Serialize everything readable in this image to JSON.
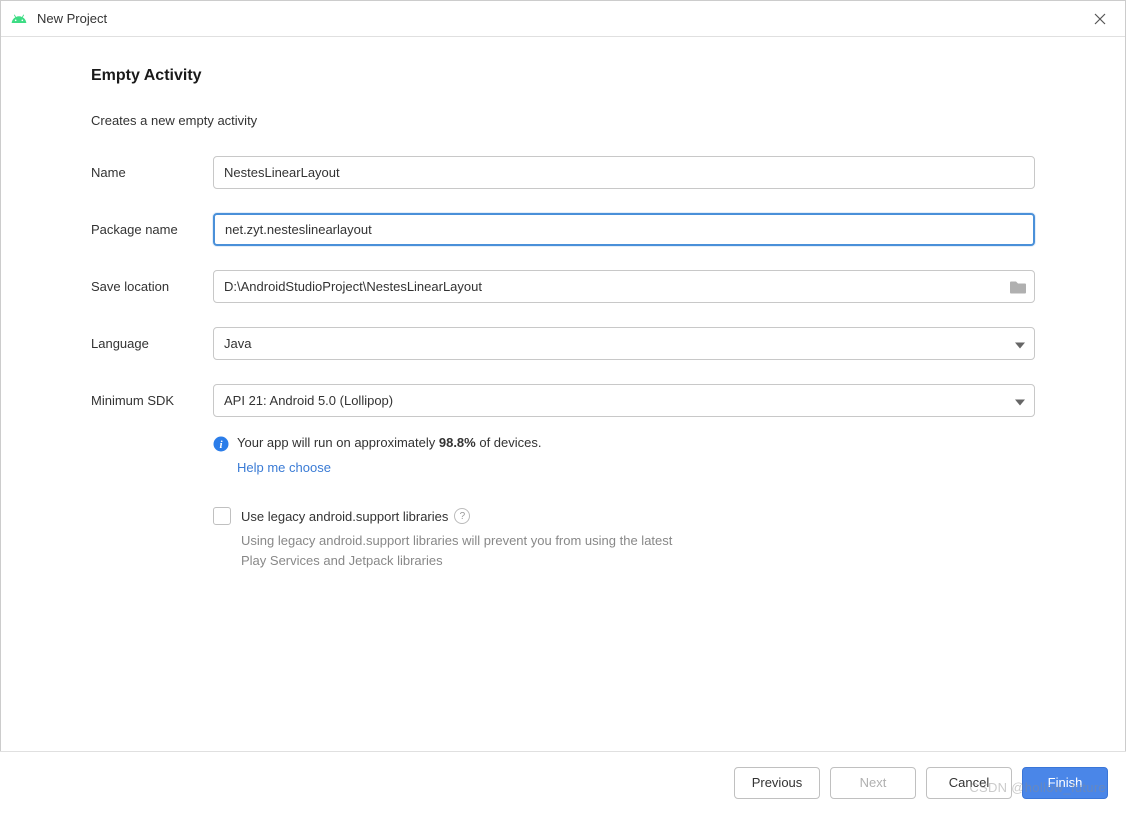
{
  "window": {
    "title": "New Project"
  },
  "page": {
    "heading": "Empty Activity",
    "description": "Creates a new empty activity"
  },
  "form": {
    "name": {
      "label": "Name",
      "value": "NestesLinearLayout"
    },
    "package_name": {
      "label": "Package name",
      "value": "net.zyt.nesteslinearlayout"
    },
    "save_location": {
      "label": "Save location",
      "value": "D:\\AndroidStudioProject\\NestesLinearLayout"
    },
    "language": {
      "label": "Language",
      "value": "Java"
    },
    "minimum_sdk": {
      "label": "Minimum SDK",
      "value": "API 21: Android 5.0 (Lollipop)"
    }
  },
  "info": {
    "text_prefix": "Your app will run on approximately ",
    "percentage": "98.8%",
    "text_suffix": " of devices.",
    "help_link": "Help me choose"
  },
  "legacy": {
    "checkbox_label": "Use legacy android.support libraries",
    "hint": "Using legacy android.support libraries will prevent you from using the latest Play Services and Jetpack libraries"
  },
  "footer": {
    "previous": "Previous",
    "next": "Next",
    "cancel": "Cancel",
    "finish": "Finish"
  },
  "watermark": "CSDN @hollow_future"
}
